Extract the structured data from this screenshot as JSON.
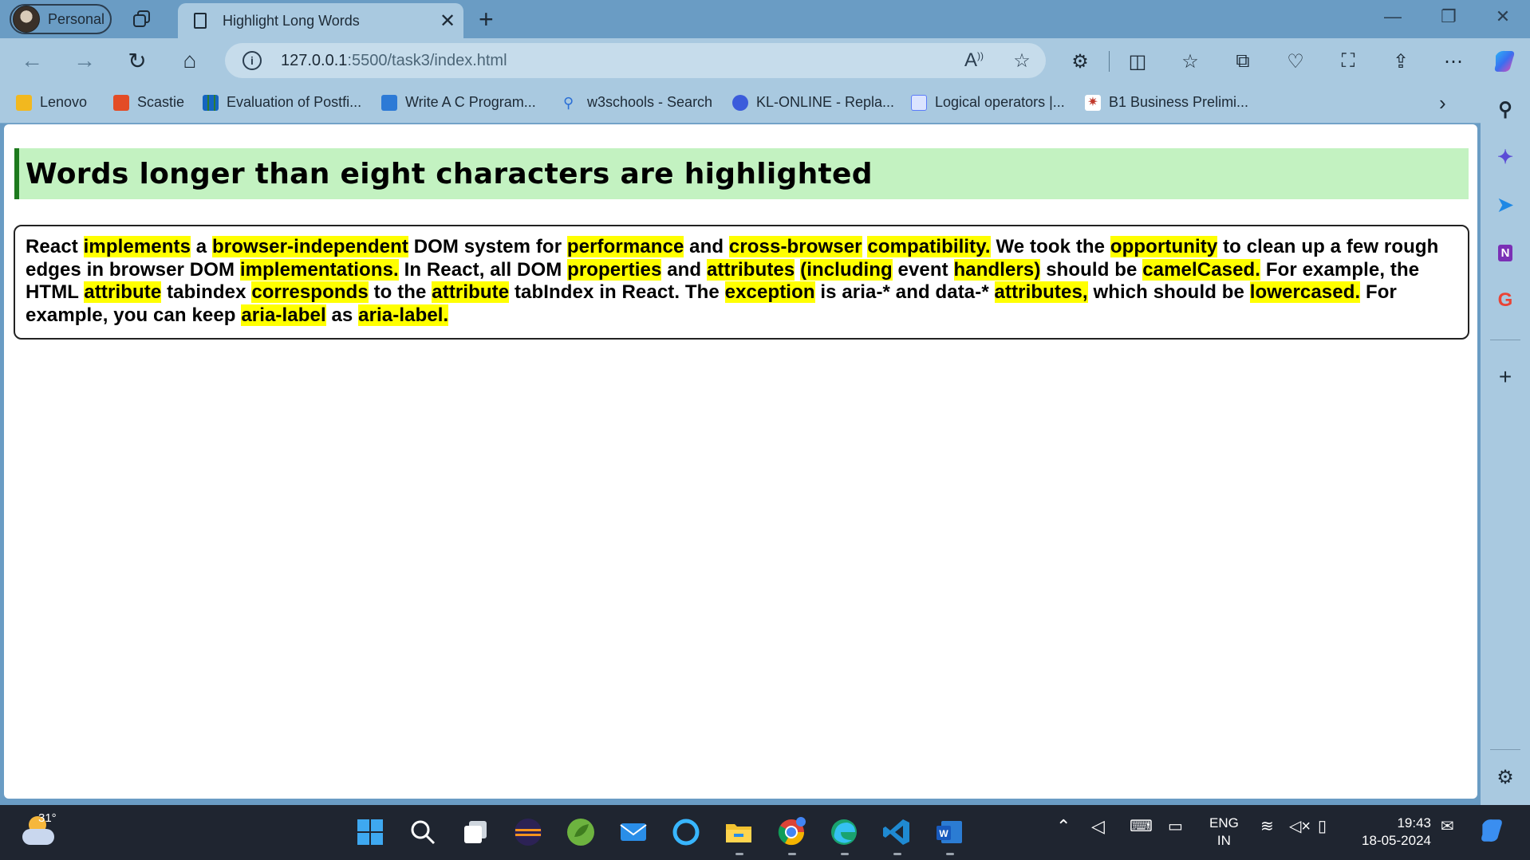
{
  "browser": {
    "profile_label": "Personal",
    "tab_title": "Highlight Long Words",
    "url_host": "127.0.0.1",
    "url_path": ":5500/task3/index.html",
    "favorites": [
      {
        "label": "Lenovo",
        "icon": "folder-icon",
        "color": "#f2b81f"
      },
      {
        "label": "Scastie",
        "icon": "scastie-icon",
        "color": "#e34c26"
      },
      {
        "label": "Evaluation of Postfi...",
        "icon": "gfg-grid-icon",
        "color": "#2e7d32"
      },
      {
        "label": "Write A C Program...",
        "icon": "code-icon",
        "color": "#2d7ad6"
      },
      {
        "label": "w3schools - Search",
        "icon": "search-icon",
        "color": "#2b6fd6"
      },
      {
        "label": "KL-ONLINE - Repla...",
        "icon": "kl-icon",
        "color": "#3b5bdb"
      },
      {
        "label": "Logical operators |...",
        "icon": "doc-icon",
        "color": "#5c7cfa"
      },
      {
        "label": "B1 Business Prelimi...",
        "icon": "star-burst-icon",
        "color": "#c0392b"
      }
    ]
  },
  "page": {
    "heading": "Words longer than eight characters are highlighted",
    "paragraph": [
      {
        "t": "React ",
        "h": false
      },
      {
        "t": "implements",
        "h": true
      },
      {
        "t": " a ",
        "h": false
      },
      {
        "t": "browser-independent",
        "h": true
      },
      {
        "t": " DOM system for ",
        "h": false
      },
      {
        "t": "performance",
        "h": true
      },
      {
        "t": " and ",
        "h": false
      },
      {
        "t": "cross-browser",
        "h": true
      },
      {
        "t": " ",
        "h": false
      },
      {
        "t": "compatibility.",
        "h": true
      },
      {
        "t": " We took the ",
        "h": false
      },
      {
        "t": "opportunity",
        "h": true
      },
      {
        "t": " to clean up a few rough edges in browser DOM ",
        "h": false
      },
      {
        "t": "implementations.",
        "h": true
      },
      {
        "t": " In React, all DOM ",
        "h": false
      },
      {
        "t": "properties",
        "h": true
      },
      {
        "t": " and ",
        "h": false
      },
      {
        "t": "attributes",
        "h": true
      },
      {
        "t": " ",
        "h": false
      },
      {
        "t": "(including",
        "h": true
      },
      {
        "t": " event ",
        "h": false
      },
      {
        "t": "handlers)",
        "h": true
      },
      {
        "t": " should be ",
        "h": false
      },
      {
        "t": "camelCased.",
        "h": true
      },
      {
        "t": " For example, the HTML ",
        "h": false
      },
      {
        "t": "attribute",
        "h": true
      },
      {
        "t": " tabindex ",
        "h": false
      },
      {
        "t": "corresponds",
        "h": true
      },
      {
        "t": " to the ",
        "h": false
      },
      {
        "t": "attribute",
        "h": true
      },
      {
        "t": " tabIndex in React. The ",
        "h": false
      },
      {
        "t": "exception",
        "h": true
      },
      {
        "t": " is aria-* and data-* ",
        "h": false
      },
      {
        "t": "attributes,",
        "h": true
      },
      {
        "t": " which should be ",
        "h": false
      },
      {
        "t": "lowercased.",
        "h": true
      },
      {
        "t": " For example, you can keep ",
        "h": false
      },
      {
        "t": "aria-label",
        "h": true
      },
      {
        "t": " as ",
        "h": false
      },
      {
        "t": "aria-label.",
        "h": true
      }
    ],
    "highlight_color": "#ffff00",
    "heading_bg": "#c3f2c1"
  },
  "taskbar": {
    "temperature": "31°",
    "lang_line1": "ENG",
    "lang_line2": "IN",
    "time": "19:43",
    "date": "18-05-2024",
    "apps": [
      "windows-start-icon",
      "search-icon",
      "task-view-icon",
      "eclipse-icon",
      "spring-icon",
      "mail-icon",
      "cortana-icon",
      "file-explorer-icon",
      "chrome-icon",
      "edge-icon",
      "vscode-icon",
      "word-icon"
    ]
  }
}
